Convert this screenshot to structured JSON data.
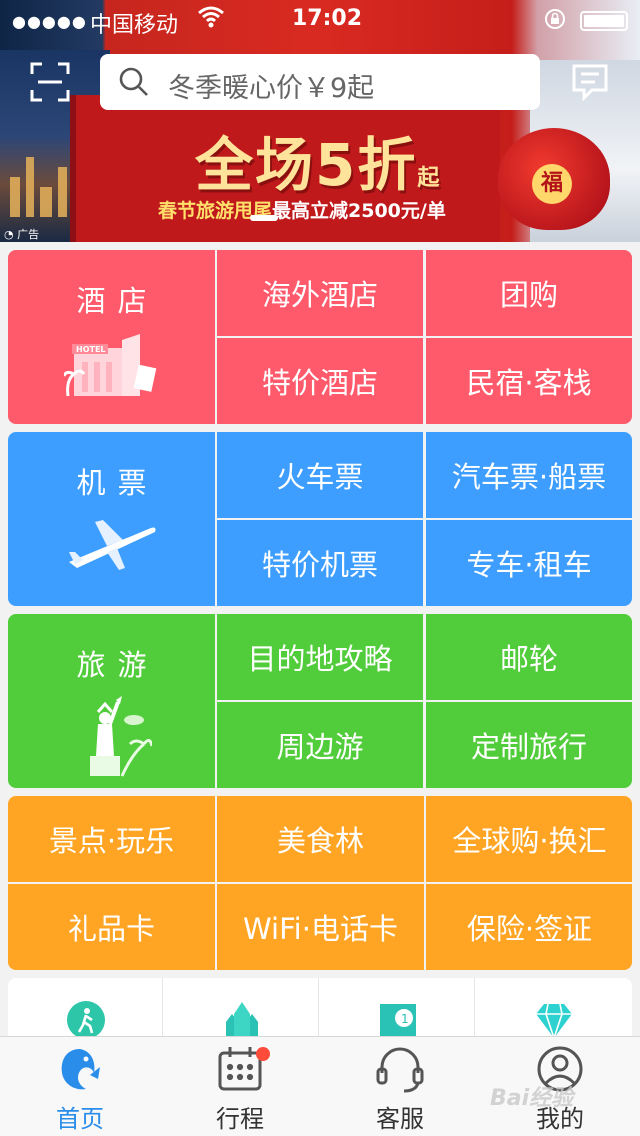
{
  "status_bar": {
    "signal": "●●●●●",
    "carrier": "中国移动",
    "time": "17:02"
  },
  "search": {
    "placeholder": "冬季暖心价￥9起"
  },
  "banner": {
    "headline": "全场5折",
    "headline_suffix": "起",
    "subline_a": "春节旅游甩尾",
    "subline_b": "最高立减2500元/单",
    "ad_label": "广告",
    "bag_char": "福"
  },
  "sections": {
    "hotel": {
      "main": "酒店",
      "items": [
        "海外酒店",
        "团购",
        "特价酒店",
        "民宿·客栈"
      ]
    },
    "flight": {
      "main": "机票",
      "items": [
        "火车票",
        "汽车票·船票",
        "特价机票",
        "专车·租车"
      ]
    },
    "travel": {
      "main": "旅游",
      "items": [
        "目的地攻略",
        "邮轮",
        "周边游",
        "定制旅行"
      ]
    },
    "more": {
      "items": [
        "景点·玩乐",
        "美食林",
        "全球购·换汇",
        "礼品卡",
        "WiFi·电话卡",
        "保险·签证"
      ]
    }
  },
  "colors": {
    "hotel": "#ff5a6b",
    "flight": "#3d9eff",
    "travel": "#51cc3a",
    "more": "#ffa523",
    "accent": "#2b8dea"
  },
  "tabbar": {
    "items": [
      {
        "label": "首页",
        "icon": "dolphin-home-icon"
      },
      {
        "label": "行程",
        "icon": "calendar-icon"
      },
      {
        "label": "客服",
        "icon": "headset-icon"
      },
      {
        "label": "我的",
        "icon": "user-icon"
      }
    ]
  },
  "watermark": "Bai经验"
}
